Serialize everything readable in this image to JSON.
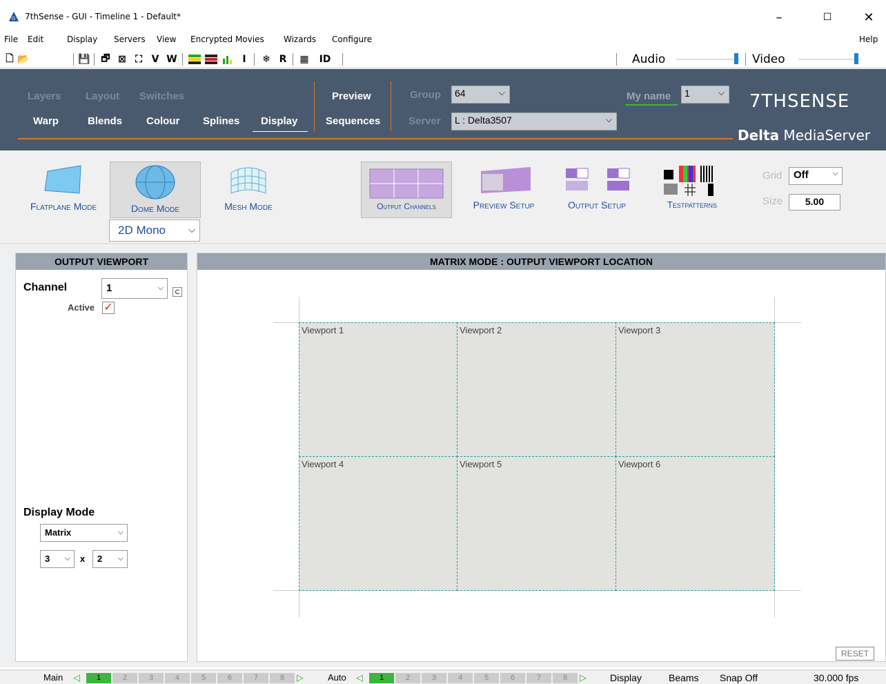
{
  "window": {
    "title": "7thSense -  GUI  - Timeline 1  - Default*"
  },
  "menu": [
    "File",
    "Edit",
    "Display",
    "Servers",
    "View",
    "Encrypted Movies",
    "Wizards",
    "Configure"
  ],
  "menu_help": "Help",
  "toolbar": {
    "v_label": "V",
    "w_label": "W",
    "i_label": "I",
    "r_label": "R",
    "id_label": "ID",
    "audio_label": "Audio",
    "video_label": "Video",
    "audio_level": 0.95,
    "video_level": 0.95
  },
  "header": {
    "nav_top": [
      "Layers",
      "Layout",
      "Switches"
    ],
    "nav_bottom": [
      "Warp",
      "Blends",
      "Colour",
      "Splines",
      "Display"
    ],
    "preview": "Preview",
    "sequences": "Sequences",
    "group_label": "Group",
    "group_value": "64",
    "server_label": "Server",
    "server_value": "L : Delta3507",
    "myname_label": "My name",
    "myname_value": "1",
    "logo": "7THSENSE",
    "brand_bold": "Delta",
    "brand_rest": " MediaServer",
    "accent": "#d27a2c"
  },
  "modes": {
    "flatplane": "Flatplane Mode",
    "dome": "Dome Mode",
    "mesh": "Mesh Mode",
    "output_channels": "Output Channels",
    "preview_setup": "Preview Setup",
    "output_setup": "Output Setup",
    "testpatterns": "Testpatterns",
    "dome_select": "2D Mono",
    "grid_label": "Grid",
    "grid_value": "Off",
    "size_label": "Size",
    "size_value": "5.00"
  },
  "left_panel": {
    "title": "OUTPUT VIEWPORT",
    "channel_label": "Channel",
    "channel_value": "1",
    "active_label": "Active",
    "display_mode_label": "Display Mode",
    "display_mode_value": "Matrix",
    "cols": "3",
    "x_label": "x",
    "rows": "2"
  },
  "right_panel": {
    "title": "MATRIX MODE : OUTPUT VIEWPORT LOCATION",
    "viewports": [
      "Viewport 1",
      "Viewport 2",
      "Viewport 3",
      "Viewport 4",
      "Viewport 5",
      "Viewport 6"
    ],
    "reset": "RESET"
  },
  "status": {
    "main_label": "Main",
    "main_cells": [
      "1",
      "2",
      "3",
      "4",
      "5",
      "6",
      "7",
      "8"
    ],
    "auto_label": "Auto",
    "auto_cells": [
      "1",
      "2",
      "3",
      "4",
      "5",
      "6",
      "7",
      "8"
    ],
    "display": "Display",
    "beams": "Beams",
    "snap": "Snap Off",
    "fps": "30.000 fps"
  }
}
